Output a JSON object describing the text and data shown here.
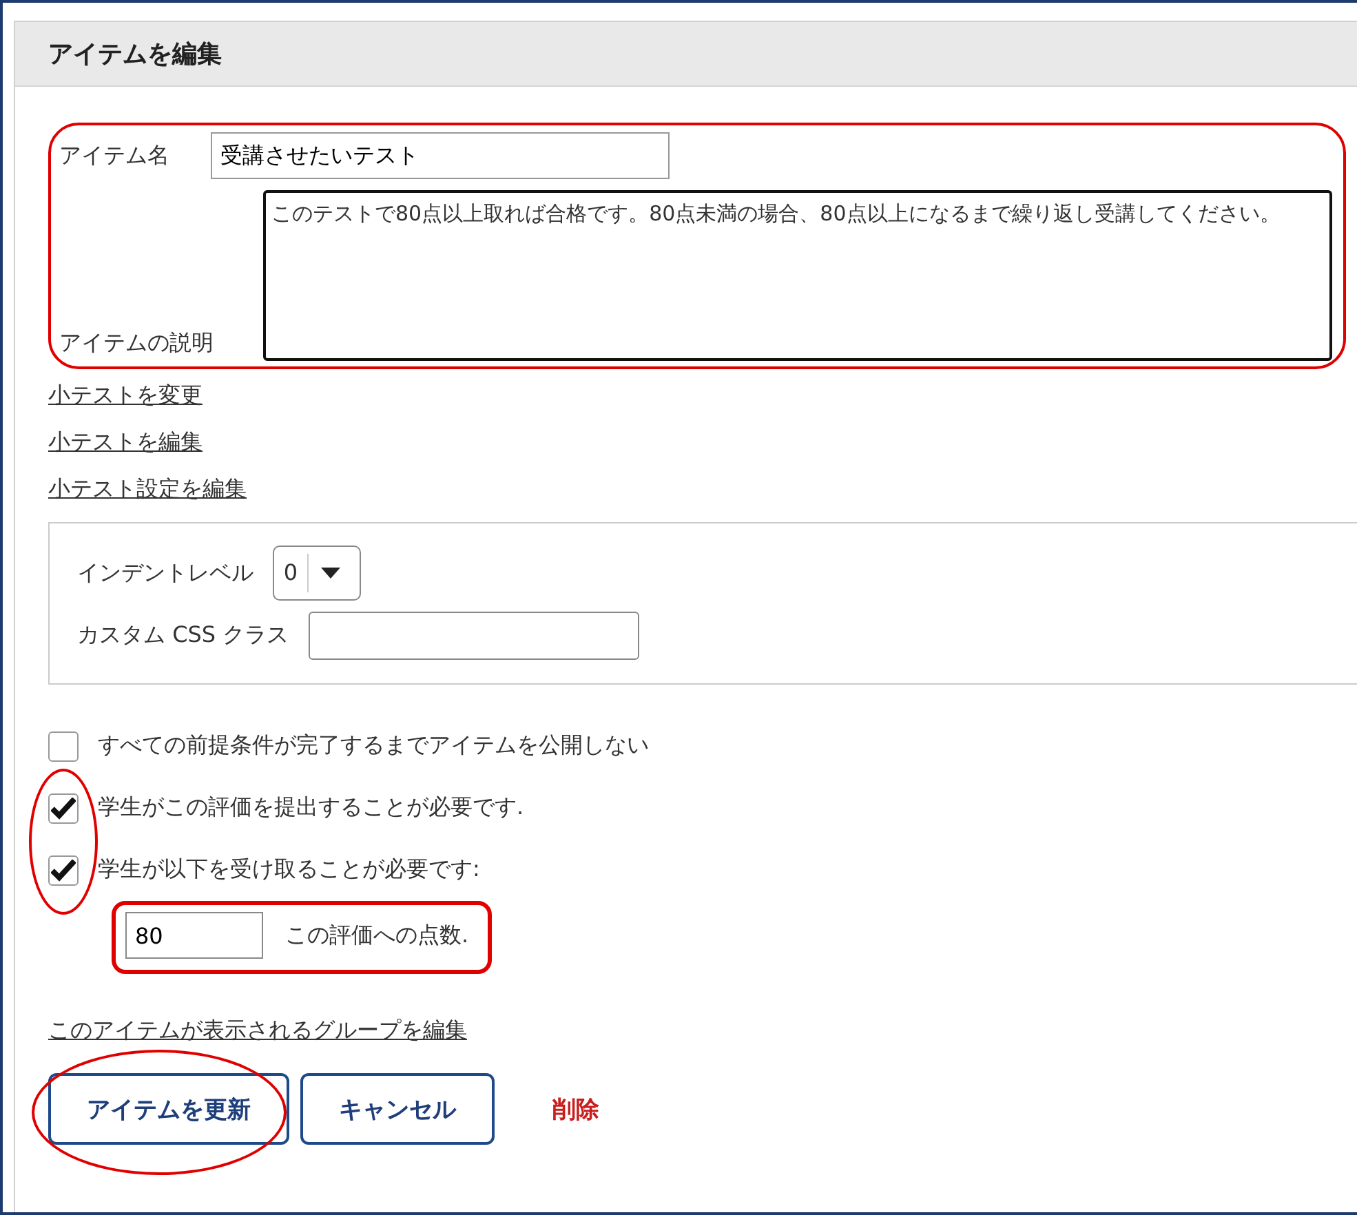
{
  "header": {
    "title": "アイテムを編集"
  },
  "details": {
    "highlighted": true,
    "name": {
      "label": "アイテム名",
      "value": "受講させたいテスト"
    },
    "description": {
      "label": "アイテムの説明",
      "value": "このテストで80点以上取れば合格です。80点未満の場合、80点以上になるまで繰り返し受講してください。"
    }
  },
  "links": [
    "小テストを変更",
    "小テストを編集",
    "小テスト設定を編集"
  ],
  "settings": {
    "indent": {
      "label": "インデントレベル",
      "value": "0"
    },
    "css_class": {
      "label": "カスタム CSS クラス"
    }
  },
  "checked_options_circled": true,
  "options": [
    {
      "label": "すべての前提条件が完了するまでアイテムを公開しない",
      "checked": false
    },
    {
      "label": "学生がこの評価を提出することが必要です.",
      "checked": true
    },
    {
      "label": "学生が以下を受け取ることが必要です:",
      "checked": true
    }
  ],
  "score": {
    "value": "80",
    "label": "この評価への点数.",
    "highlighted": true
  },
  "group_link": "このアイテムが表示されるグループを編集",
  "buttons": [
    {
      "label": "アイテムを更新",
      "kind": "primary",
      "highlighted": true
    },
    {
      "label": "キャンセル",
      "kind": "primary",
      "highlighted": false
    },
    {
      "label": "削除",
      "kind": "danger",
      "highlighted": false
    }
  ]
}
